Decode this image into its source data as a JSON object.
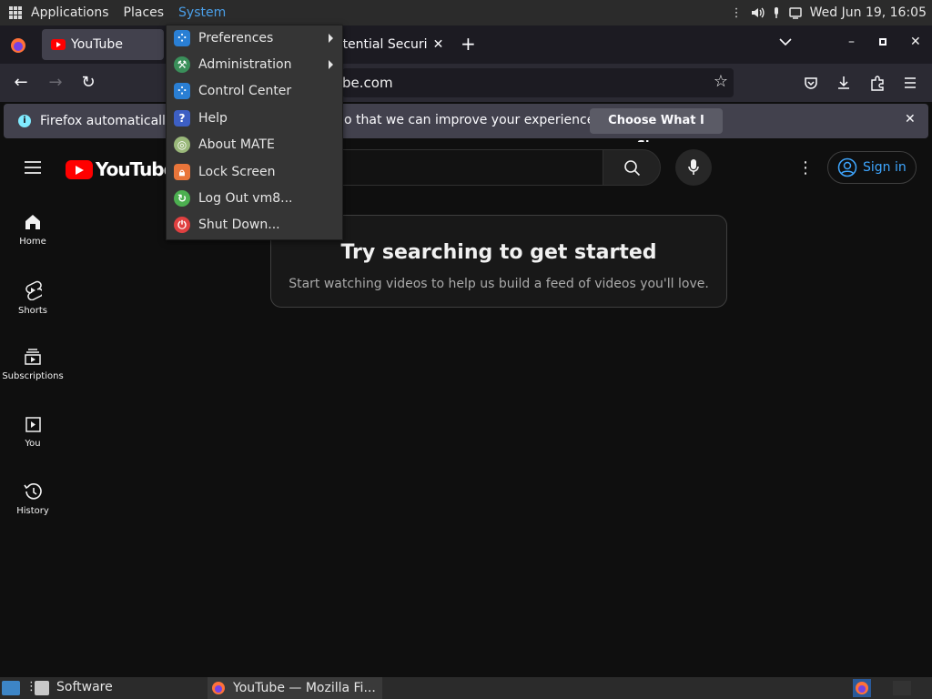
{
  "top_panel": {
    "applications_label": "Applications",
    "places_label": "Places",
    "system_label": "System",
    "clock": "Wed Jun 19, 16:05"
  },
  "system_menu": {
    "items": [
      {
        "label": "Preferences",
        "icon": "preferences-icon",
        "color": "#2a7fd4",
        "submenu": true
      },
      {
        "label": "Administration",
        "icon": "administration-icon",
        "color": "#3a8f5a",
        "submenu": true
      },
      {
        "label": "Control Center",
        "icon": "control-center-icon",
        "color": "#2a7fd4",
        "submenu": false
      },
      {
        "label": "Help",
        "icon": "help-icon",
        "color": "#3d5fc4",
        "submenu": false
      },
      {
        "label": "About MATE",
        "icon": "mate-logo-icon",
        "color": "#9ab87a",
        "submenu": false
      },
      {
        "label": "Lock Screen",
        "icon": "lock-icon",
        "color": "#e9753a",
        "submenu": false
      },
      {
        "label": "Log Out vm8...",
        "icon": "logout-icon",
        "color": "#4caf50",
        "submenu": false
      },
      {
        "label": "Shut Down...",
        "icon": "power-icon",
        "color": "#e04040",
        "submenu": false
      }
    ]
  },
  "browser": {
    "tabs": [
      {
        "title": "YouTube",
        "active": true
      },
      {
        "title": "otential Securi",
        "active": false
      }
    ],
    "url_fragment": "be.com",
    "notification": {
      "text_left": "Firefox automatically",
      "text_right": "o that we can improve your experience.",
      "button": "Choose What I Share"
    }
  },
  "youtube": {
    "logo_text": "YouTube",
    "sign_in": "Sign in",
    "sidebar": [
      {
        "label": "Home",
        "icon": "home-icon"
      },
      {
        "label": "Shorts",
        "icon": "shorts-icon"
      },
      {
        "label": "Subscriptions",
        "icon": "subscriptions-icon"
      },
      {
        "label": "You",
        "icon": "you-icon"
      },
      {
        "label": "History",
        "icon": "history-icon"
      }
    ],
    "empty_title": "Try searching to get started",
    "empty_subtitle": "Start watching videos to help us build a feed of videos you'll love."
  },
  "bottom_panel": {
    "software_label": "Software",
    "taskbar_item": "YouTube — Mozilla Fi..."
  }
}
